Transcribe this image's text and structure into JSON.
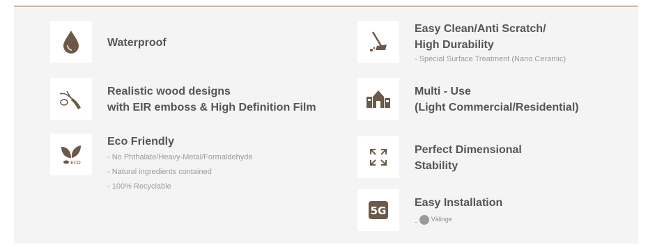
{
  "colors": {
    "panel_bg": "#f4f4f4",
    "accent_line": "#c9b69a",
    "icon_color": "#6b5a47",
    "title_color": "#555555",
    "sub_color": "#9b9b9b"
  },
  "features": {
    "waterproof": {
      "icon": "water-drop-icon",
      "title": "Waterproof"
    },
    "easy_clean": {
      "icon": "mop-broom-icon",
      "title_line1": "Easy Clean/Anti Scratch/",
      "title_line2": "High Durability",
      "sub": "- Special Surface Treatment (Nano Ceramic)"
    },
    "realistic": {
      "icon": "wood-branch-icon",
      "title_line1": "Realistic wood designs",
      "title_line2": "with EIR emboss & High Definition Film"
    },
    "multi_use": {
      "icon": "buildings-icon",
      "title_line1": "Multi - Use",
      "title_line2": "(Light Commercial/Residential)"
    },
    "eco": {
      "icon": "eco-leaves-icon",
      "icon_text": "ECO",
      "title": "Eco Friendly",
      "subs": [
        "- No Phthalate/Heavy-Metal/Formaldehyde",
        "- Natural ingredients contained",
        "- 100% Recyclable"
      ]
    },
    "stability": {
      "icon": "expand-arrows-icon",
      "title_line1": "Perfect Dimensional",
      "title_line2": "Stability"
    },
    "installation": {
      "icon": "5g-badge-icon",
      "icon_text": "5G",
      "title": "Easy Installation",
      "sub_prefix": "-",
      "badge_text": "Välinge"
    }
  }
}
